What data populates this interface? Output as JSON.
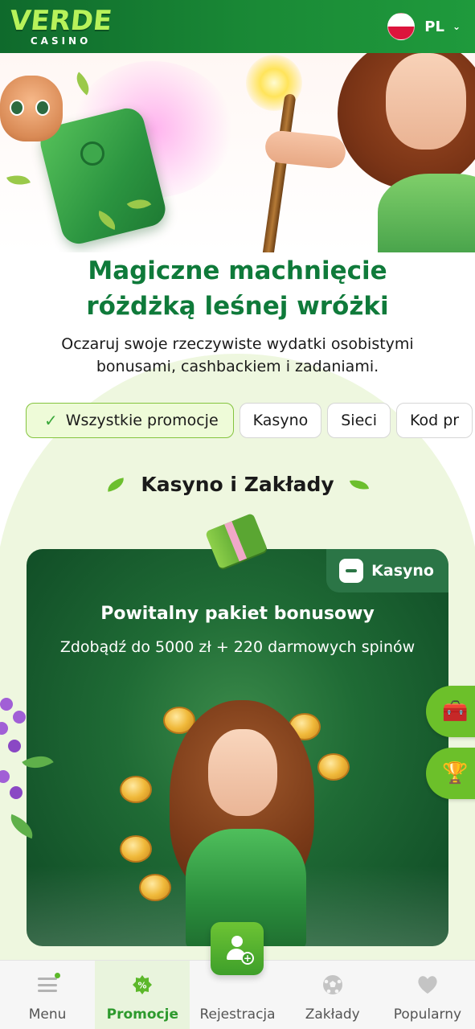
{
  "header": {
    "logo_main": "VERDE",
    "logo_sub": "CASINO",
    "language": "PL",
    "flag_icon": "poland-flag-icon"
  },
  "hero": {
    "title_line1": "Magiczne machnięcie",
    "title_line2": "różdżką leśnej wróżki",
    "subtitle_line1": "Oczaruj swoje rzeczywiste wydatki osobistymi",
    "subtitle_line2": "bonusami, cashbackiem i zadaniami."
  },
  "filters": [
    {
      "label": "Wszystkie promocje",
      "active": true
    },
    {
      "label": "Kasyno",
      "active": false
    },
    {
      "label": "Sieci",
      "active": false
    },
    {
      "label": "Kod pr",
      "active": false
    }
  ],
  "section": {
    "title": "Kasyno i Zakłady"
  },
  "promo_card": {
    "tag": "Kasyno",
    "title": "Powitalny pakiet bonusowy",
    "subtitle": "Zdobądź do 5000 zł + 220 darmowych spinów"
  },
  "side_buttons": [
    {
      "icon": "treasure-chest-icon",
      "glyph": "🧰"
    },
    {
      "icon": "trophy-icon",
      "glyph": "🏆"
    }
  ],
  "bottom_nav": [
    {
      "label": "Menu",
      "icon": "menu-icon",
      "active": false
    },
    {
      "label": "Promocje",
      "icon": "percent-badge-icon",
      "active": true
    },
    {
      "label": "Rejestracja",
      "icon": "add-user-icon",
      "active": false
    },
    {
      "label": "Zakłady",
      "icon": "soccer-ball-icon",
      "active": false
    },
    {
      "label": "Popularny",
      "icon": "heart-icon",
      "active": false
    }
  ],
  "colors": {
    "brand_green": "#1a8a36",
    "accent_lime": "#b7f25a",
    "title_green": "#0f7a3a",
    "card_green": "#1f6b35"
  }
}
